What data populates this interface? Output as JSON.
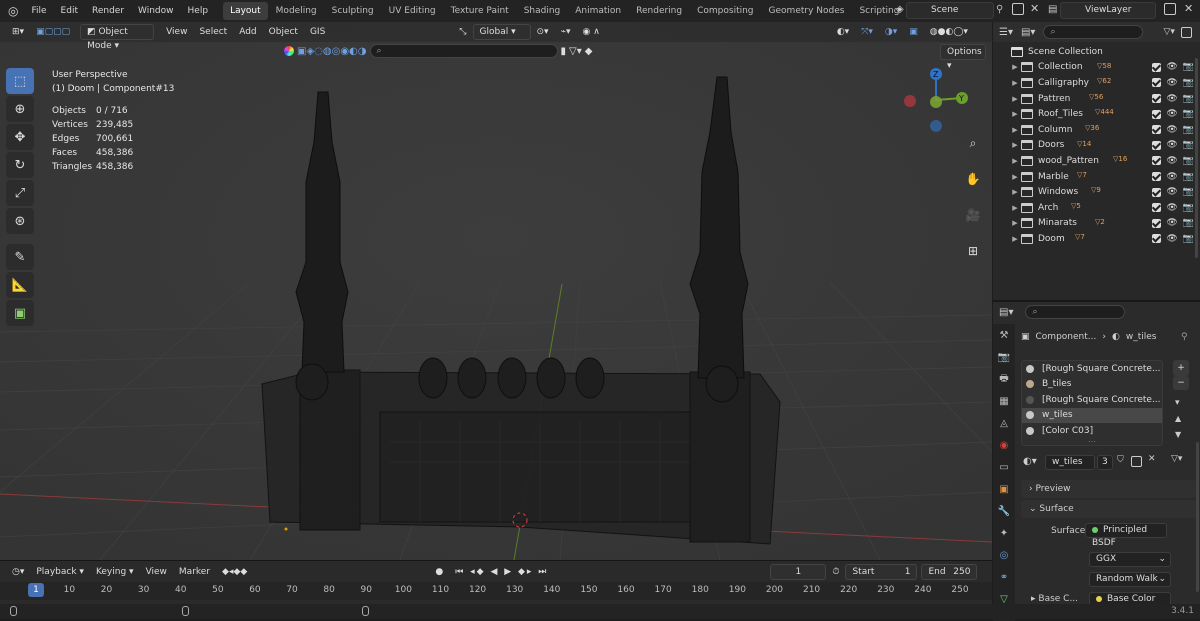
{
  "topbar": {
    "menus": [
      "File",
      "Edit",
      "Render",
      "Window",
      "Help"
    ],
    "workspaces": [
      "Layout",
      "Modeling",
      "Sculpting",
      "UV Editing",
      "Texture Paint",
      "Shading",
      "Animation",
      "Rendering",
      "Compositing",
      "Geometry Nodes",
      "Scripting"
    ],
    "active_workspace": "Layout",
    "scene": "Scene",
    "view_layer": "ViewLayer"
  },
  "viewport": {
    "mode": "Object Mode",
    "menus": [
      "View",
      "Select",
      "Add",
      "Object",
      "GIS"
    ],
    "orientation": "Global",
    "options_label": "Options",
    "perspective": "User Perspective",
    "active": "(1) Doom | Component#13",
    "stats": [
      {
        "key": "Objects",
        "value": "0 / 716"
      },
      {
        "key": "Vertices",
        "value": "239,485"
      },
      {
        "key": "Edges",
        "value": "700,661"
      },
      {
        "key": "Faces",
        "value": "458,386"
      },
      {
        "key": "Triangles",
        "value": "458,386"
      }
    ],
    "gizmo": {
      "z": "Z",
      "y": "Y",
      "x_color": "#c7373f",
      "y_color": "#6a9f2a",
      "z_color": "#2f73c8"
    }
  },
  "timeline": {
    "menus": [
      "Playback",
      "Keying",
      "View",
      "Marker"
    ],
    "current_frame": "1",
    "start_label": "Start",
    "start": "1",
    "end_label": "End",
    "end": "250",
    "frames": [
      "1",
      "10",
      "20",
      "30",
      "40",
      "50",
      "60",
      "70",
      "80",
      "90",
      "100",
      "110",
      "120",
      "130",
      "140",
      "150",
      "160",
      "170",
      "180",
      "190",
      "200",
      "210",
      "220",
      "230",
      "240",
      "250"
    ]
  },
  "outliner": {
    "root": "Scene Collection",
    "items": [
      {
        "name": "Collection",
        "count": "58"
      },
      {
        "name": "Calligraphy",
        "count": "62"
      },
      {
        "name": "Pattren",
        "count": "56"
      },
      {
        "name": "Roof_Tiles",
        "count": "444"
      },
      {
        "name": "Column",
        "count": "36"
      },
      {
        "name": "Doors",
        "count": "14"
      },
      {
        "name": "wood_Pattren",
        "count": "16"
      },
      {
        "name": "Marble",
        "count": "7"
      },
      {
        "name": "Windows",
        "count": "9"
      },
      {
        "name": "Arch",
        "count": "5"
      },
      {
        "name": "Minarats",
        "count": "2"
      },
      {
        "name": "Doom",
        "count": "7"
      }
    ]
  },
  "properties": {
    "object": "Component...",
    "material": "w_tiles",
    "materials": [
      "[Rough Square Concrete...",
      "B_tiles",
      "[Rough Square Concrete...",
      "w_tiles",
      "[Color C03]"
    ],
    "selected_index": 3,
    "mat_name": "w_tiles",
    "users": "3",
    "preview_label": "Preview",
    "surface_label": "Surface",
    "surface_field_label": "Surface",
    "surface_value": "Principled BSDF",
    "distribution": "GGX",
    "subsurface": "Random Walk",
    "base_label": "Base C...",
    "base_value": "Base Color"
  },
  "status": {
    "version": "3.4.1"
  }
}
